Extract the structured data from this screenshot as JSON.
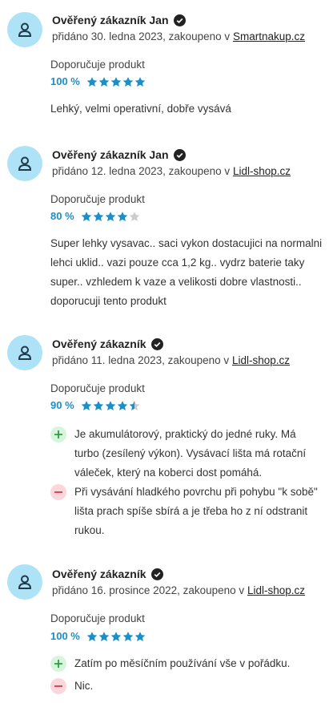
{
  "colors": {
    "accent": "#1a8fc9",
    "star_filled": "#1a8fc9",
    "star_empty": "#cccccc",
    "avatar_bg": "#aee3f7",
    "plus_bg": "#d6f5dc",
    "minus_bg": "#fbd6dc"
  },
  "reviews": [
    {
      "author": "Ověřený zákazník Jan",
      "meta_prefix": "přidáno 30. ledna 2023, zakoupeno v ",
      "shop": "Smartnakup.cz",
      "recommend": "Doporučuje produkt",
      "percent": "100 %",
      "rating": 5,
      "text": "Lehký, velmi operativní, dobře vysává"
    },
    {
      "author": "Ověřený zákazník Jan",
      "meta_prefix": "přidáno 12. ledna 2023, zakoupeno v ",
      "shop": "Lidl-shop.cz",
      "recommend": "Doporučuje produkt",
      "percent": "80 %",
      "rating": 4,
      "text": "Super lehky vysavac.. saci vykon dostacujici na normalni lehci uklid.. vazi pouze cca 1,2 kg.. vydrz baterie taky super.. vzhledem k vaze a velikosti dobre vlastnosti.. doporucuji tento produkt"
    },
    {
      "author": "Ověřený zákazník",
      "meta_prefix": "přidáno 11. ledna 2023, zakoupeno v ",
      "shop": "Lidl-shop.cz",
      "recommend": "Doporučuje produkt",
      "percent": "90 %",
      "rating": 4.5,
      "plus": "Je akumulátorový, praktický do jedné ruky. Má turbo (zesílený výkon). Vysávací lišta má rotační váleček, který na koberci dost pomáhá.",
      "minus": "Při vysávání hladkého povrchu při pohybu \"k sobě\" lišta prach spíše sbírá a je třeba ho z ní odstranit rukou."
    },
    {
      "author": "Ověřený zákazník",
      "meta_prefix": "přidáno 16. prosince 2022, zakoupeno v ",
      "shop": "Lidl-shop.cz",
      "recommend": "Doporučuje produkt",
      "percent": "100 %",
      "rating": 5,
      "plus": "Zatím po měsíčním používání vše v pořádku.",
      "minus": "Nic."
    }
  ]
}
